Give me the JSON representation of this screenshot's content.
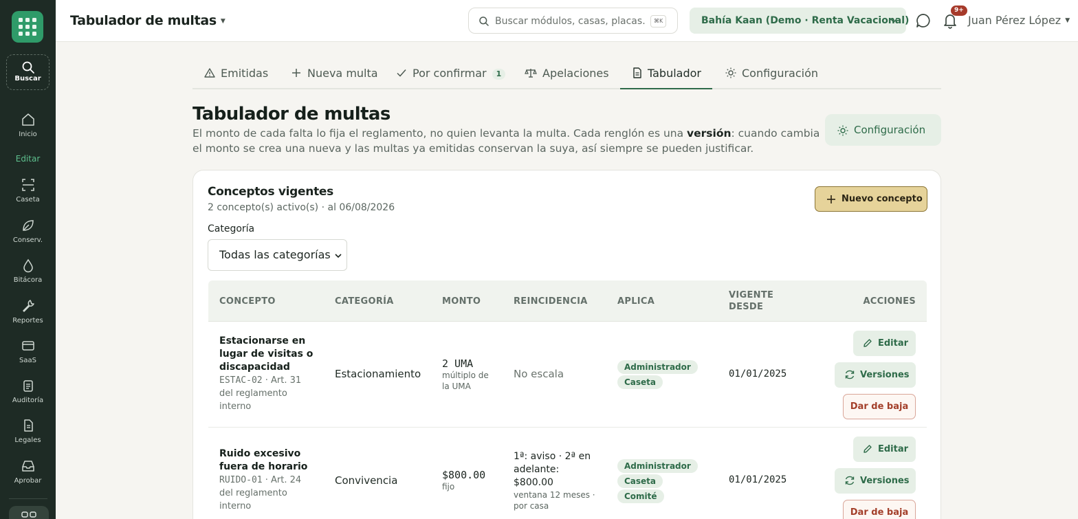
{
  "sidebar": {
    "search_label": "Buscar",
    "section_label": "Editar",
    "items": [
      {
        "label": "Inicio",
        "icon": "home-icon"
      },
      {
        "label": "Caseta",
        "icon": "scan-icon"
      },
      {
        "label": "Conserv.",
        "icon": "leaf-icon"
      },
      {
        "label": "Bitácora",
        "icon": "drop-icon"
      },
      {
        "label": "Reportes",
        "icon": "wrench-icon"
      },
      {
        "label": "SaaS",
        "icon": "card-icon"
      },
      {
        "label": "Auditoría",
        "icon": "clipboard-icon"
      },
      {
        "label": "Legales",
        "icon": "document-icon"
      },
      {
        "label": "Aprobar",
        "icon": "inbox-icon"
      }
    ]
  },
  "header": {
    "title": "Tabulador de multas",
    "search_placeholder": "Buscar módulos, casas, placas…",
    "search_shortcut": "⌘K",
    "organization": "Bahía Kaan (Demo · Renta Vacacional)",
    "notifications_badge": "9+",
    "user_name": "Juan Pérez López"
  },
  "tabs": {
    "items": [
      {
        "label": "Emitidas",
        "icon": "warning-icon"
      },
      {
        "label": "Nueva multa",
        "icon": "plus-icon"
      },
      {
        "label": "Por confirmar",
        "icon": "check-icon",
        "count": "1"
      },
      {
        "label": "Apelaciones",
        "icon": "scale-icon"
      },
      {
        "label": "Tabulador",
        "icon": "document-icon",
        "active": true
      },
      {
        "label": "Configuración",
        "icon": "sun-icon"
      }
    ]
  },
  "page": {
    "title": "Tabulador de multas",
    "desc_before": "El monto de cada falta lo fija el reglamento, no quien levanta la multa. Cada renglón es una ",
    "desc_bold": "versión",
    "desc_after": ": cuando cambia el monto se crea una nueva y las multas ya emitidas conservan la suya, así siempre se pueden justificar.",
    "config_button": "Configuración"
  },
  "card": {
    "title": "Conceptos vigentes",
    "subtitle": "2 concepto(s) activo(s) · al 06/08/2026",
    "new_button": "Nuevo concepto",
    "category_label": "Categoría",
    "category_selected": "Todas las categorías"
  },
  "table": {
    "headers": {
      "concept": "CONCEPTO",
      "category": "CATEGORÍA",
      "amount": "MONTO",
      "recurrence": "REINCIDENCIA",
      "applies": "APLICA",
      "valid_from": "VIGENTE DESDE",
      "actions": "ACCIONES"
    },
    "actions": {
      "edit": "Editar",
      "versions": "Versiones",
      "deactivate": "Dar de baja"
    },
    "rows": [
      {
        "name": "Estacionarse en lugar de visitas o discapacidad",
        "code": "ESTAC-02",
        "reference": " · Art. 31 del reglamento interno",
        "category": "Estacionamiento",
        "amount": "2 UMA",
        "amount_note": "múltiplo de la UMA",
        "recurrence": "No escala",
        "recurrence_note": "",
        "applies": [
          "Administrador",
          "Caseta"
        ],
        "valid_from": "01/01/2025"
      },
      {
        "name": "Ruido excesivo fuera de horario",
        "code": "RUIDO-01",
        "reference": " · Art. 24 del reglamento interno",
        "category": "Convivencia",
        "amount": "$800.00",
        "amount_note": "fijo",
        "recurrence": "1ª: aviso · 2ª en adelante: $800.00",
        "recurrence_note": "ventana 12 meses · por casa",
        "applies": [
          "Administrador",
          "Caseta",
          "Comité"
        ],
        "valid_from": "01/01/2025"
      }
    ]
  },
  "colors": {
    "sidebar_bg": "#1e2b25",
    "accent_green": "#2e6b49",
    "accent_soft": "#e6efe6",
    "primary_button": "#e6d39a",
    "danger": "#a33f2a",
    "badge": "#a63a2a"
  }
}
